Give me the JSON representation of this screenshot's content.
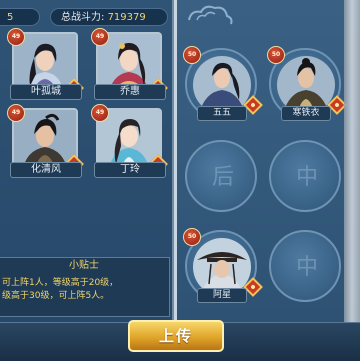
{
  "header": {
    "level_fragment": "5",
    "power_label": "总战斗力:",
    "power_value": "719379"
  },
  "roster": [
    {
      "name": "叶孤城",
      "level": "49"
    },
    {
      "name": "乔惠",
      "level": "49"
    },
    {
      "name": "化清风",
      "level": "49"
    },
    {
      "name": "丁玲",
      "level": "49"
    }
  ],
  "tips": {
    "title": "小贴士",
    "line1": "可上阵1人，等级高于20级，",
    "line2": "级高于30级，可上阵5人。"
  },
  "formation": {
    "slots": [
      {
        "name": "五五",
        "level": "50",
        "filled": true
      },
      {
        "name": "寒铁衣",
        "level": "50",
        "filled": true
      },
      {
        "char": "后",
        "filled": false
      },
      {
        "char": "中",
        "filled": false
      },
      {
        "name": "阿星",
        "level": "50",
        "filled": true
      },
      {
        "char": "中",
        "filled": false
      }
    ]
  },
  "actions": {
    "upload_label": "上传"
  },
  "colors": {
    "accent_gold": "#f0d56b",
    "element_badge": "#c83a21"
  }
}
